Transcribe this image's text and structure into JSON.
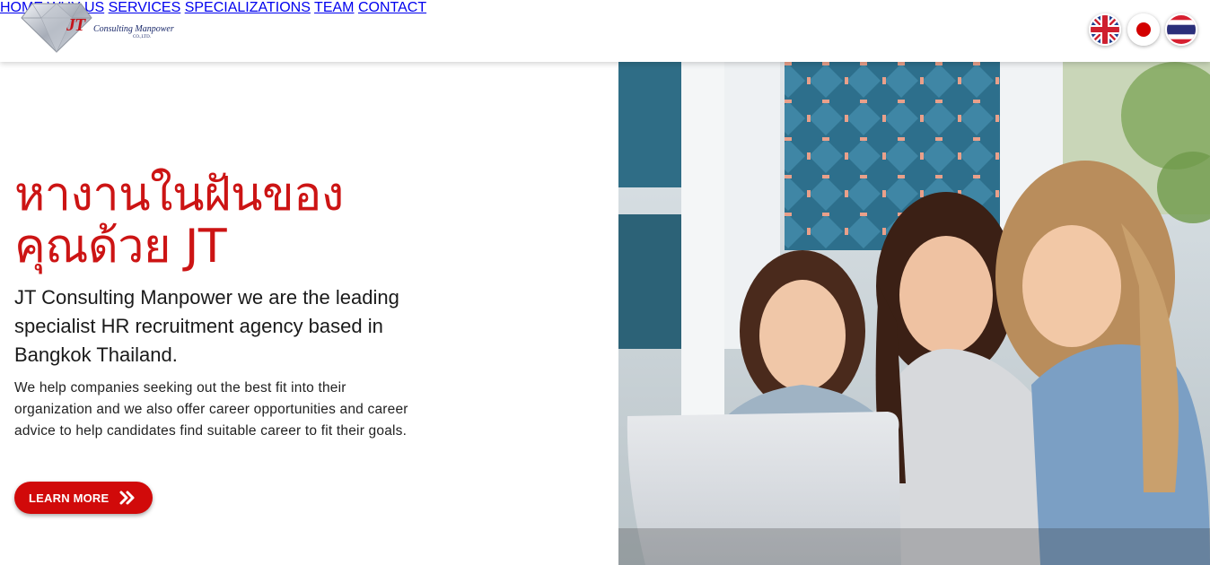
{
  "header": {
    "logo": {
      "mark": "JT",
      "name": "Consulting Manpower",
      "suffix": "CO.,LTD."
    },
    "nav": [
      {
        "label": "HOME"
      },
      {
        "label": "WHY US"
      },
      {
        "label": "SERVICES"
      },
      {
        "label": "SPECIALIZATIONS"
      },
      {
        "label": "TEAM"
      },
      {
        "label": "CONTACT"
      }
    ],
    "languages": [
      {
        "icon": "uk-flag-icon"
      },
      {
        "icon": "japan-flag-icon"
      },
      {
        "icon": "thailand-flag-icon"
      }
    ]
  },
  "hero": {
    "title_line1": "หางานในฝันของ",
    "title_line2": "คุณด้วย JT",
    "lead": "JT Consulting Manpower we are the leading specialist HR recruitment agency based in Bangkok Thailand.",
    "body": "We help companies seeking out the best fit into their organization and we also offer career opportunities and career advice to help candidates find suitable career to fit their goals.",
    "cta_label": "LEARN MORE",
    "cta_icon": "double-chevron-right-icon"
  },
  "colors": {
    "accent": "#cc1414",
    "button": "#d10a0a",
    "text": "#1a1a1a",
    "nav_text": "#222222"
  }
}
